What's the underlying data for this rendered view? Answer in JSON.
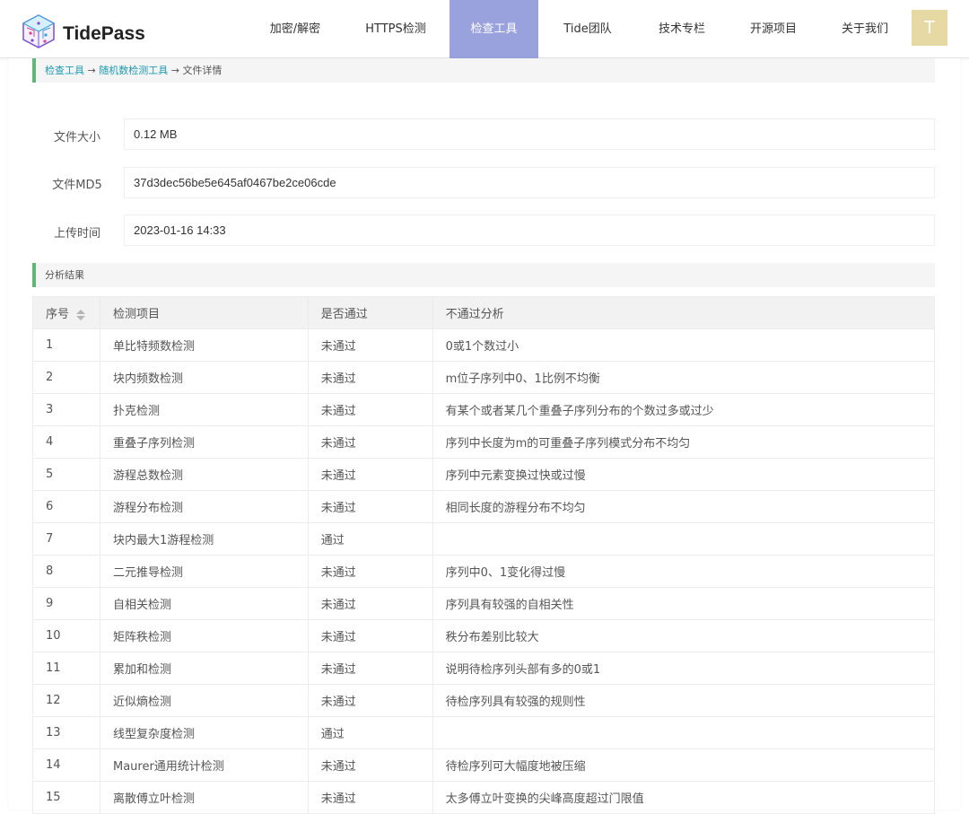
{
  "header": {
    "brand": "TidePass",
    "nav": [
      {
        "label": "加密/解密"
      },
      {
        "label": "HTTPS检测"
      },
      {
        "label": "检查工具",
        "active": true
      },
      {
        "label": "Tide团队"
      },
      {
        "label": "技术专栏"
      },
      {
        "label": "开源项目"
      },
      {
        "label": "关于我们"
      }
    ],
    "avatar_letter": "T"
  },
  "breadcrumb": {
    "item1": "检查工具",
    "sep1": " → ",
    "item2": "随机数检测工具",
    "sep2": " → ",
    "current": "文件详情"
  },
  "file_info": {
    "size_label": "文件大小",
    "size_value": "0.12 MB",
    "md5_label": "文件MD5",
    "md5_value": "37d3dec56be5e645af0467be2ce06cde",
    "time_label": "上传时间",
    "time_value": "2023-01-16 14:33"
  },
  "analysis": {
    "title": "分析结果",
    "columns": [
      "序号",
      "检测项目",
      "是否通过",
      "不通过分析"
    ],
    "rows": [
      [
        "1",
        "单比特频数检测",
        "未通过",
        "0或1个数过小"
      ],
      [
        "2",
        "块内频数检测",
        "未通过",
        "m位子序列中0、1比例不均衡"
      ],
      [
        "3",
        "扑克检测",
        "未通过",
        "有某个或者某几个重叠子序列分布的个数过多或过少"
      ],
      [
        "4",
        "重叠子序列检测",
        "未通过",
        "序列中长度为m的可重叠子序列模式分布不均匀"
      ],
      [
        "5",
        "游程总数检测",
        "未通过",
        "序列中元素变换过快或过慢"
      ],
      [
        "6",
        "游程分布检测",
        "未通过",
        "相同长度的游程分布不均匀"
      ],
      [
        "7",
        "块内最大1游程检测",
        "通过",
        ""
      ],
      [
        "8",
        "二元推导检测",
        "未通过",
        "序列中0、1变化得过慢"
      ],
      [
        "9",
        "自相关检测",
        "未通过",
        "序列具有较强的自相关性"
      ],
      [
        "10",
        "矩阵秩检测",
        "未通过",
        "秩分布差别比较大"
      ],
      [
        "11",
        "累加和检测",
        "未通过",
        "说明待检序列头部有多的0或1"
      ],
      [
        "12",
        "近似熵检测",
        "未通过",
        "待检序列具有较强的规则性"
      ],
      [
        "13",
        "线型复杂度检测",
        "通过",
        ""
      ],
      [
        "14",
        "Maurer通用统计检测",
        "未通过",
        "待检序列可大幅度地被压缩"
      ],
      [
        "15",
        "离散傅立叶检测",
        "未通过",
        "太多傅立叶变换的尖峰高度超过门限值"
      ]
    ]
  },
  "colors": {
    "nav_active": "#9aa2dd",
    "accent_bar": "#5fb878",
    "link": "#1b9bb4",
    "avatar_bg": "#e6d9a4"
  }
}
